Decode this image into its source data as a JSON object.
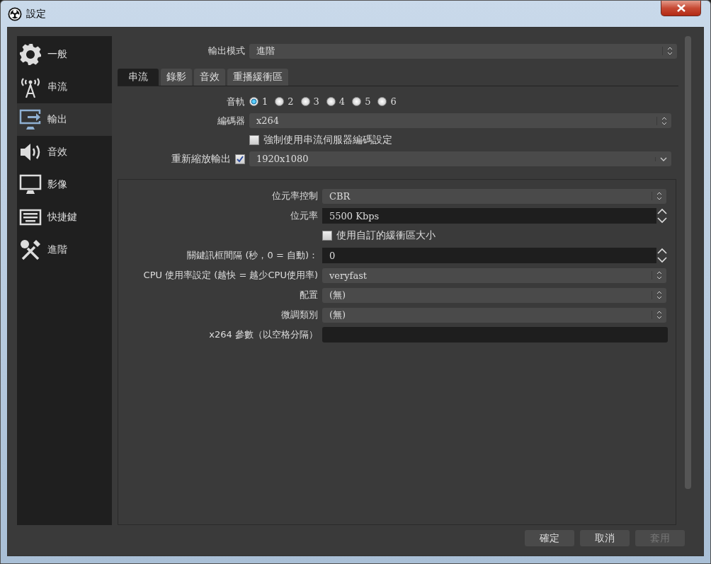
{
  "window": {
    "title": "設定"
  },
  "sidebar": {
    "items": [
      {
        "label": "一般",
        "selected": false
      },
      {
        "label": "串流",
        "selected": false
      },
      {
        "label": "輸出",
        "selected": true
      },
      {
        "label": "音效",
        "selected": false
      },
      {
        "label": "影像",
        "selected": false
      },
      {
        "label": "快捷鍵",
        "selected": false
      },
      {
        "label": "進階",
        "selected": false
      }
    ]
  },
  "output_mode": {
    "label": "輸出模式",
    "value": "進階"
  },
  "tabs": [
    {
      "label": "串流",
      "selected": true
    },
    {
      "label": "錄影",
      "selected": false
    },
    {
      "label": "音效",
      "selected": false
    },
    {
      "label": "重播緩衝區",
      "selected": false
    }
  ],
  "audio_track": {
    "label": "音軌",
    "options": [
      {
        "label": "1",
        "selected": true
      },
      {
        "label": "2",
        "selected": false
      },
      {
        "label": "3",
        "selected": false
      },
      {
        "label": "4",
        "selected": false
      },
      {
        "label": "5",
        "selected": false
      },
      {
        "label": "6",
        "selected": false
      }
    ]
  },
  "encoder": {
    "label": "編碼器",
    "value": "x264"
  },
  "enforce": {
    "label": "強制使用串流伺服器編碼設定",
    "checked": false
  },
  "rescale": {
    "label": "重新縮放輸出",
    "checked": true,
    "value": "1920x1080"
  },
  "encoder_settings": [
    {
      "kind": "select",
      "label": "位元率控制",
      "value": "CBR"
    },
    {
      "kind": "spin",
      "label": "位元率",
      "value": "5500 Kbps"
    },
    {
      "kind": "checkbox",
      "label": "使用自訂的緩衝區大小",
      "checked": false
    },
    {
      "kind": "spin",
      "label": "關鍵訊框間隔 (秒，0 = 自動)：",
      "value": "0"
    },
    {
      "kind": "select",
      "label": "CPU 使用率設定 (越快 = 越少CPU使用率)",
      "value": "veryfast"
    },
    {
      "kind": "select",
      "label": "配置",
      "value": "(無)"
    },
    {
      "kind": "select",
      "label": "微調類別",
      "value": "(無)"
    },
    {
      "kind": "text",
      "label": "x264 參數（以空格分隔）"
    }
  ],
  "buttons": [
    {
      "label": "確定",
      "disabled": false
    },
    {
      "label": "取消",
      "disabled": false
    },
    {
      "label": "套用",
      "disabled": true
    }
  ]
}
